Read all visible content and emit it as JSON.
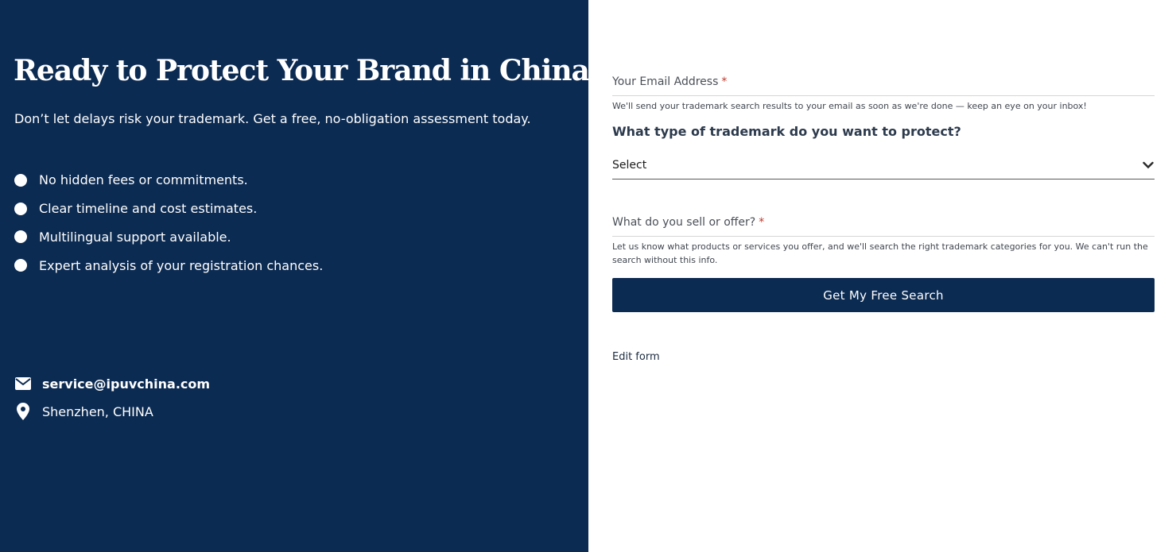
{
  "left_panel": {
    "headline": "Ready to Protect Your Brand in China?",
    "subtitle": "Don’t let delays risk your trademark. Get a free, no-obligation assessment today.",
    "bullets": [
      "No hidden fees or commitments.",
      "Clear timeline and cost estimates.",
      "Multilingual support available.",
      "Expert analysis of your registration chances."
    ],
    "contact": {
      "email": "service@ipuvchina.com",
      "location": "Shenzhen, CHINA"
    }
  },
  "form": {
    "email": {
      "label": "Your Email Address",
      "required_mark": "*",
      "help": "We'll send your trademark search results to your email as soon as we're done — keep an eye on your inbox!"
    },
    "trademark_type": {
      "question": "What type of trademark do you want to protect?",
      "selected": "Select"
    },
    "offering": {
      "label": "What do you sell or offer?",
      "required_mark": "*",
      "help": "Let us know what products or services you offer, and we'll search the right trademark categories for you. We can't run the search without this info."
    },
    "submit_label": "Get My Free Search",
    "edit_link": "Edit form"
  },
  "colors": {
    "panel_bg": "#0c2b52",
    "button_bg": "#0c2b52",
    "required": "#c0392b"
  },
  "icons": {
    "email": "envelope-icon",
    "location": "map-pin-icon",
    "select": "chevron-down-icon"
  }
}
